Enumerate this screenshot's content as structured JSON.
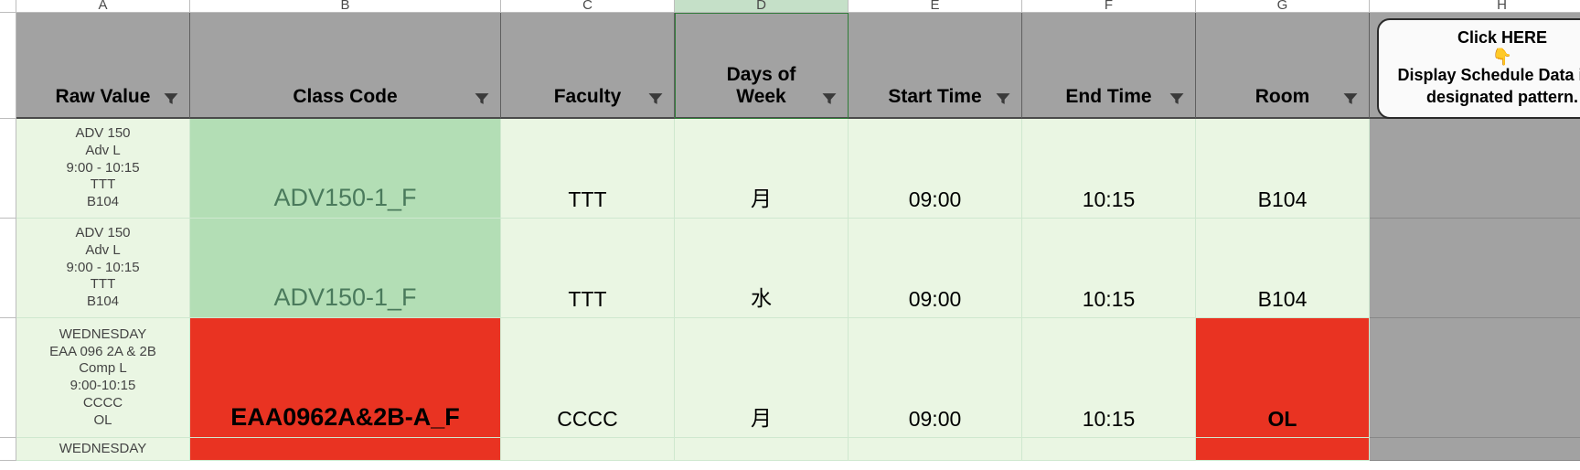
{
  "columns": {
    "letters": [
      "A",
      "B",
      "C",
      "D",
      "E",
      "F",
      "G",
      "H"
    ],
    "active_index": 3,
    "headers": {
      "A": "Raw Value",
      "B": "Class Code",
      "C": "Faculty",
      "D": "Days of\nWeek",
      "E": "Start Time",
      "F": "End Time",
      "G": "Room"
    }
  },
  "button": {
    "line1": "Click HERE",
    "emoji": "👇",
    "line2": "Display Schedule Data in a designated pattern."
  },
  "rows": [
    {
      "raw": "ADV 150\nAdv L\n9:00 - 10:15\nTTT\nB104",
      "class_code": "ADV150-1_F",
      "class_code_style": "green",
      "faculty": "TTT",
      "day": "月",
      "start": "09:00",
      "end": "10:15",
      "room": "B104",
      "room_style": "normal"
    },
    {
      "raw": "ADV 150\nAdv L\n9:00 - 10:15\nTTT\nB104",
      "class_code": "ADV150-1_F",
      "class_code_style": "green",
      "faculty": "TTT",
      "day": "水",
      "start": "09:00",
      "end": "10:15",
      "room": "B104",
      "room_style": "normal"
    },
    {
      "raw": "WEDNESDAY\nEAA 096 2A & 2B\nComp L\n9:00-10:15\nCCCC\nOL",
      "class_code": "EAA0962A&2B-A_F",
      "class_code_style": "red",
      "faculty": "CCCC",
      "day": "月",
      "start": "09:00",
      "end": "10:15",
      "room": "OL",
      "room_style": "red"
    },
    {
      "raw": "WEDNESDAY",
      "class_code": "",
      "class_code_style": "red",
      "faculty": "",
      "day": "",
      "start": "",
      "end": "",
      "room": "",
      "room_style": "red"
    }
  ]
}
